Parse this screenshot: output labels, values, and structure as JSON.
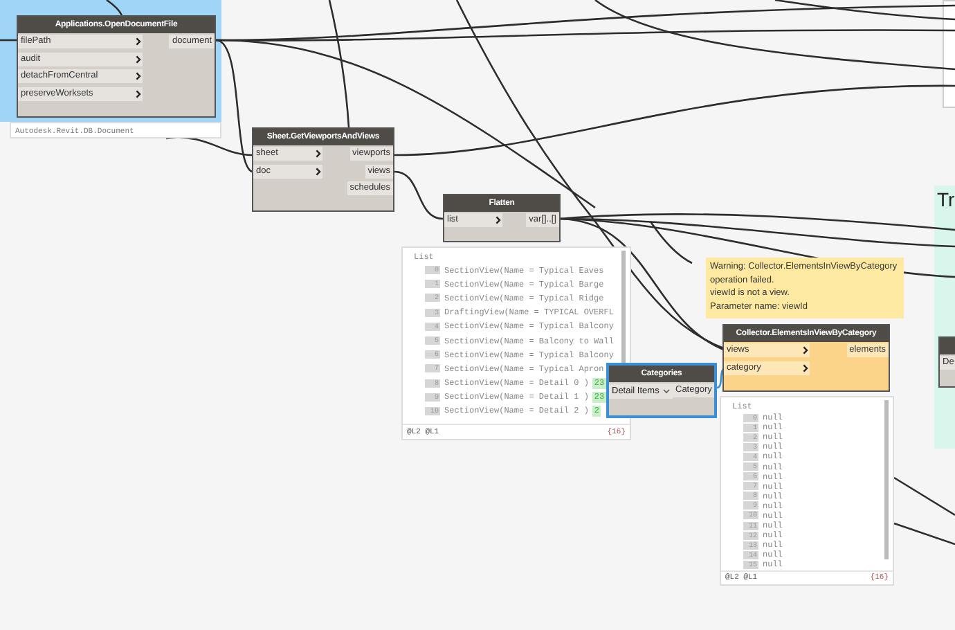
{
  "groups": [
    {
      "kind": "blue"
    },
    {
      "kind": "green",
      "title": "Tr"
    }
  ],
  "nodes": [
    {
      "title": "Applications.OpenDocumentFile",
      "failed": false,
      "selected": false,
      "inputs": [
        "filePath",
        "audit",
        "detachFromCentral",
        "preserveWorksets"
      ],
      "outputs": [
        "document"
      ],
      "preview": {
        "kind": "value",
        "text": "Autodesk.Revit.DB.Document"
      }
    },
    {
      "title": "Sheet.GetViewportsAndViews",
      "failed": false,
      "selected": false,
      "inputs": [
        "sheet",
        "doc"
      ],
      "outputs": [
        "viewports",
        "views",
        "schedules"
      ]
    },
    {
      "title": "Flatten",
      "failed": false,
      "selected": false,
      "inputs": [
        "list"
      ],
      "outputs": [
        "var[]..[]"
      ],
      "preview": {
        "kind": "list",
        "header": "List",
        "items": [
          {
            "index": "0",
            "text": "SectionView(Name = Typical Eaves"
          },
          {
            "index": "1",
            "text": "SectionView(Name = Typical Barge"
          },
          {
            "index": "2",
            "text": "SectionView(Name = Typical Ridge"
          },
          {
            "index": "3",
            "text": "DraftingView(Name = TYPICAL OVERFL"
          },
          {
            "index": "4",
            "text": "SectionView(Name = Typical Balcony"
          },
          {
            "index": "5",
            "text": "SectionView(Name = Balcony to Wall"
          },
          {
            "index": "6",
            "text": "SectionView(Name = Typical Balcony"
          },
          {
            "index": "7",
            "text": "SectionView(Name = Typical Apron"
          },
          {
            "index": "8",
            "text": "SectionView(Name = Detail 0 )",
            "badge": "23"
          },
          {
            "index": "9",
            "text": "SectionView(Name = Detail 1 )",
            "badge": "23"
          },
          {
            "index": "10",
            "text": "SectionView(Name = Detail 2 )",
            "badge": "2"
          }
        ],
        "levels": "@L2 @L1",
        "count": "{16}"
      }
    },
    {
      "title": "Categories",
      "failed": false,
      "selected": true,
      "dropdown": "Detail Items",
      "outputs": [
        "Category"
      ]
    },
    {
      "title": "Collector.ElementsInViewByCategory",
      "failed": true,
      "selected": false,
      "inputs": [
        "views",
        "category"
      ],
      "outputs": [
        "elements"
      ],
      "warning": [
        "Warning: Collector.ElementsInViewByCategory",
        "operation failed.",
        "viewId is not a view.",
        "Parameter name: viewId"
      ],
      "preview": {
        "kind": "list",
        "header": "List",
        "items": [
          {
            "index": "0",
            "text": "null"
          },
          {
            "index": "1",
            "text": "null"
          },
          {
            "index": "2",
            "text": "null"
          },
          {
            "index": "3",
            "text": "null"
          },
          {
            "index": "4",
            "text": "null"
          },
          {
            "index": "5",
            "text": "null"
          },
          {
            "index": "6",
            "text": "null"
          },
          {
            "index": "7",
            "text": "null"
          },
          {
            "index": "8",
            "text": "null"
          },
          {
            "index": "9",
            "text": "null"
          },
          {
            "index": "10",
            "text": "null"
          },
          {
            "index": "11",
            "text": "null"
          },
          {
            "index": "12",
            "text": "null"
          },
          {
            "index": "13",
            "text": "null"
          },
          {
            "index": "14",
            "text": "null"
          },
          {
            "index": "15",
            "text": "null"
          }
        ],
        "levels": "@L2 @L1",
        "count": "{16}"
      }
    },
    {
      "failed": false,
      "selected": false,
      "inputs": [
        "De"
      ]
    }
  ]
}
